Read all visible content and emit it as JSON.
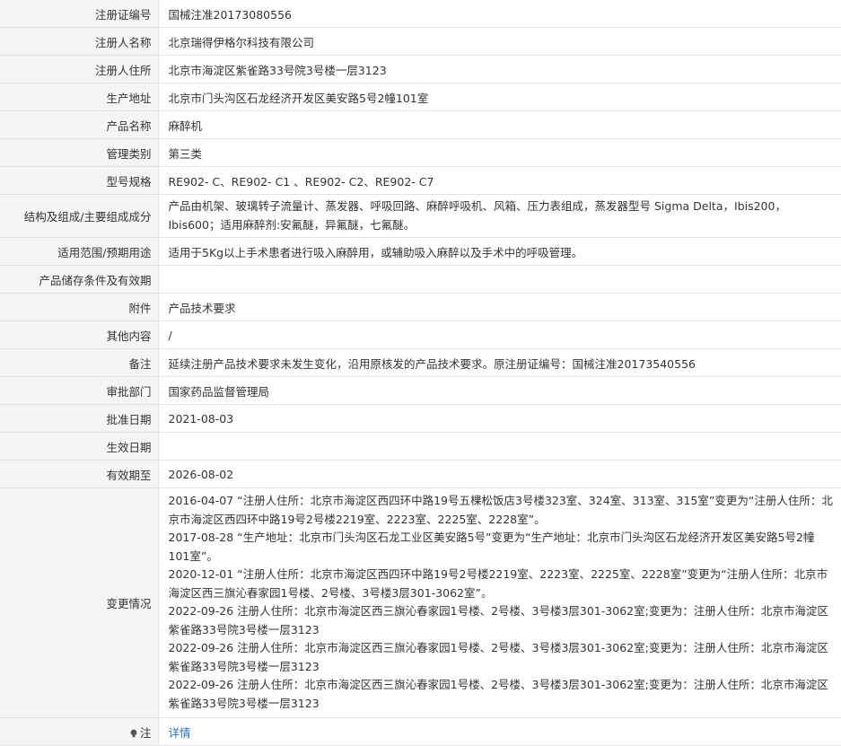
{
  "rows": [
    {
      "label": "注册证编号",
      "value": "国械注准20173080556"
    },
    {
      "label": "注册人名称",
      "value": "北京瑞得伊格尔科技有限公司"
    },
    {
      "label": "注册人住所",
      "value": "北京市海淀区紫雀路33号院3号楼一层3123"
    },
    {
      "label": "生产地址",
      "value": "北京市门头沟区石龙经济开发区美安路5号2幢101室"
    },
    {
      "label": "产品名称",
      "value": "麻醉机"
    },
    {
      "label": "管理类别",
      "value": "第三类"
    },
    {
      "label": "型号规格",
      "value": "RE902- C、RE902- C1 、RE902- C2、RE902- C7"
    },
    {
      "label": "结构及组成/主要组成成分",
      "value": "产品由机架、玻璃转子流量计、蒸发器、呼吸回路、麻醉呼吸机、风箱、压力表组成，蒸发器型号 Sigma Delta，Ibis200，Ibis600；适用麻醉剂:安氟醚，异氟醚，七氟醚。"
    },
    {
      "label": "适用范围/预期用途",
      "value": "适用于5Kg以上手术患者进行吸入麻醉用，或辅助吸入麻醉以及手术中的呼吸管理。"
    },
    {
      "label": "产品储存条件及有效期",
      "value": ""
    },
    {
      "label": "附件",
      "value": "产品技术要求"
    },
    {
      "label": "其他内容",
      "value": "/"
    },
    {
      "label": "备注",
      "value": "延续注册产品技术要求未发生变化，沿用原核发的产品技术要求。原注册证编号：国械注准20173540556"
    },
    {
      "label": "审批部门",
      "value": "国家药品监督管理局"
    },
    {
      "label": "批准日期",
      "value": "2021-08-03"
    },
    {
      "label": "生效日期",
      "value": ""
    },
    {
      "label": "有效期至",
      "value": "2026-08-02"
    }
  ],
  "changes": {
    "label": "变更情况",
    "items": [
      "2016-04-07 “注册人住所：北京市海淀区西四环中路19号五棵松饭店3号楼323室、324室、313室、315室”变更为“注册人住所：北京市海淀区西四环中路19号2号楼2219室、2223室、2225室、2228室”。",
      "2017-08-28 “生产地址：北京市门头沟区石龙工业区美安路5号”变更为“生产地址：北京市门头沟区石龙经济开发区美安路5号2幢101室”。",
      "2020-12-01 “注册人住所：北京市海淀区西四环中路19号2号楼2219室、2223室、2225室、2228室”变更为“注册人住所：北京市海淀区西三旗沁春家园1号楼、2号楼、3号楼3层301-3062室”。",
      "2022-09-26 注册人住所：北京市海淀区西三旗沁春家园1号楼、2号楼、3号楼3层301-3062室;变更为：注册人住所：北京市海淀区紫雀路33号院3号楼一层3123",
      "2022-09-26 注册人住所：北京市海淀区西三旗沁春家园1号楼、2号楼、3号楼3层301-3062室;变更为：注册人住所：北京市海淀区紫雀路33号院3号楼一层3123",
      "2022-09-26 注册人住所：北京市海淀区西三旗沁春家园1号楼、2号楼、3号楼3层301-3062室;变更为：注册人住所：北京市海淀区紫雀路33号院3号楼一层3123"
    ]
  },
  "note": {
    "label": "注",
    "icon": "lightbulb-icon",
    "link_text": "详情",
    "link_color": "#2a6db5"
  }
}
